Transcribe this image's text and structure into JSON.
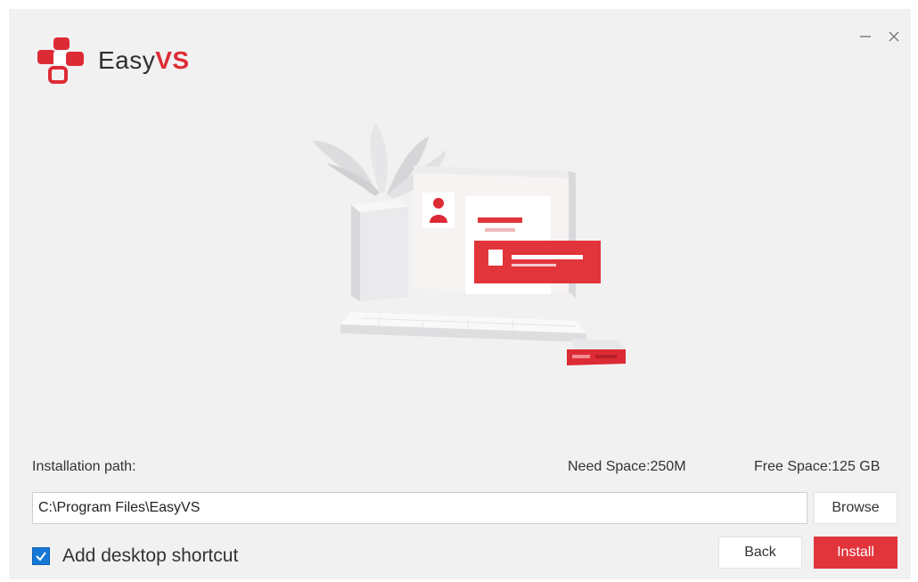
{
  "app": {
    "name_prefix": "Easy",
    "name_suffix": "VS"
  },
  "window_controls": {
    "minimize_icon": "minimize-icon",
    "close_icon": "close-icon"
  },
  "colors": {
    "accent": "#e2343b",
    "background": "#f1f1f2",
    "checkbox": "#1677d6"
  },
  "info": {
    "installation_path_label": "Installation path:",
    "need_space": "Need Space:250M",
    "free_space": "Free Space:125 GB"
  },
  "path_input": {
    "value": "C:\\Program Files\\EasyVS"
  },
  "buttons": {
    "browse": "Browse",
    "back": "Back",
    "install": "Install"
  },
  "shortcut": {
    "label": "Add desktop shortcut",
    "checked": true
  }
}
